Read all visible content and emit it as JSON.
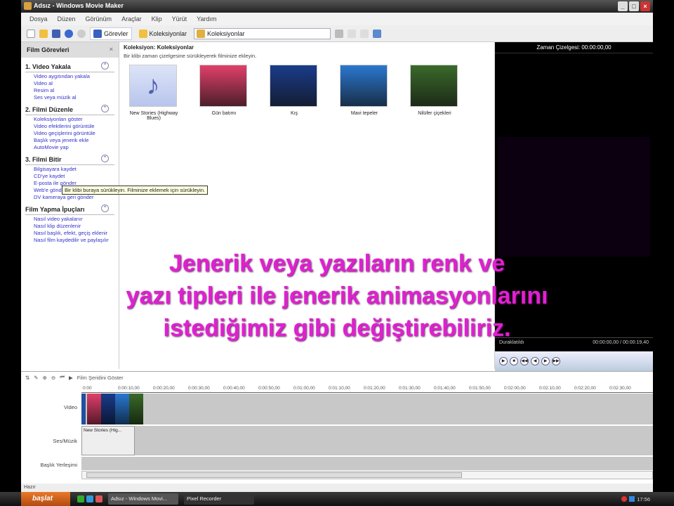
{
  "window": {
    "title": "Adsız - Windows Movie Maker",
    "controls": [
      "_",
      "□",
      "×"
    ]
  },
  "menu": [
    "Dosya",
    "Düzen",
    "Görünüm",
    "Araçlar",
    "Klip",
    "Yürüt",
    "Yardım"
  ],
  "toolbar": {
    "tasks": "Görevler",
    "collections": "Koleksiyonlar",
    "combo_value": "Koleksiyonlar"
  },
  "taskpane": {
    "title": "Film Görevleri",
    "sections": [
      {
        "title": "1. Video Yakala",
        "links": [
          "Video aygıtından yakala",
          "Video al",
          "Resim al",
          "Ses veya müzik al"
        ]
      },
      {
        "title": "2. Filmi Düzenle",
        "links": [
          "Koleksiyonları göster",
          "Video efektlerini görüntüle",
          "Video geçişlerini görüntüle",
          "Başlık veya jenerik ekle",
          "AutoMovie yap"
        ]
      },
      {
        "title": "3. Filmi Bitir",
        "links": [
          "Bilgisayara kaydet",
          "CD'ye kaydet",
          "E-posta ile gönder",
          "Web'e gönder",
          "DV kameraya geri gönder"
        ]
      },
      {
        "title": "Film Yapma İpuçları",
        "links": [
          "Nasıl video yakalanır",
          "Nasıl klip düzenlenir",
          "Nasıl başlık, efekt, geçiş eklenir",
          "Nasıl film kaydedilir ve paylaşılır"
        ]
      }
    ]
  },
  "collection": {
    "header": "Koleksiyon: Koleksiyonlar",
    "subheader": "Bir klibi zaman çizelgesine sürükleyerek filminize ekleyin.",
    "items": [
      {
        "label": "New Stories (Highway Blues)",
        "color": "#b8c4ec"
      },
      {
        "label": "Gün batımı",
        "color": "#e0406a"
      },
      {
        "label": "Kış",
        "color": "#1a3c8a"
      },
      {
        "label": "Mavi tepeler",
        "color": "#2a78d0"
      },
      {
        "label": "Nilüfer çiçekleri",
        "color": "#3a6a2a"
      }
    ]
  },
  "tooltip": "Bir klibi buraya sürükleyin. Filminize eklemek için sürükleyin.",
  "preview": {
    "header": "Zaman Çizelgesi: 00:00:00,00",
    "status": "Duraklatıldı",
    "time": "00:00:00,00 / 00:00:19,40",
    "buttons": [
      "▶",
      "■",
      "◀◀",
      "◀",
      "▶",
      "▶▶"
    ]
  },
  "timeline": {
    "show_storyboard": "Film Şeridini Göster",
    "ruler": [
      "0:00",
      "0:00:10,00",
      "0:00:20,00",
      "0:00:30,00",
      "0:00:40,00",
      "0:00:50,00",
      "0:01:00,00",
      "0:01:10,00",
      "0:01:20,00",
      "0:01:30,00",
      "0:01:40,00",
      "0:01:50,00",
      "0:02:00,00",
      "0:02:10,00",
      "0:02:20,00",
      "0:02:30,00"
    ],
    "tracks": {
      "video": "Video",
      "audio": "Ses/Müzik",
      "title": "Başlık Yerleşimi"
    },
    "audio_clip": "New Stories (Hig..."
  },
  "status": "Hazır",
  "taskbar": {
    "start": "başlat",
    "tasks": [
      "Adsız - Windows Movi...",
      "Pixel Recorder"
    ],
    "clock": "17:56"
  },
  "overlay": [
    "Jenerik veya yazıların renk ve",
    "yazı tipleri ile jenerik animasyonlarını",
    "istediğimiz gibi değiştirebiliriz."
  ]
}
